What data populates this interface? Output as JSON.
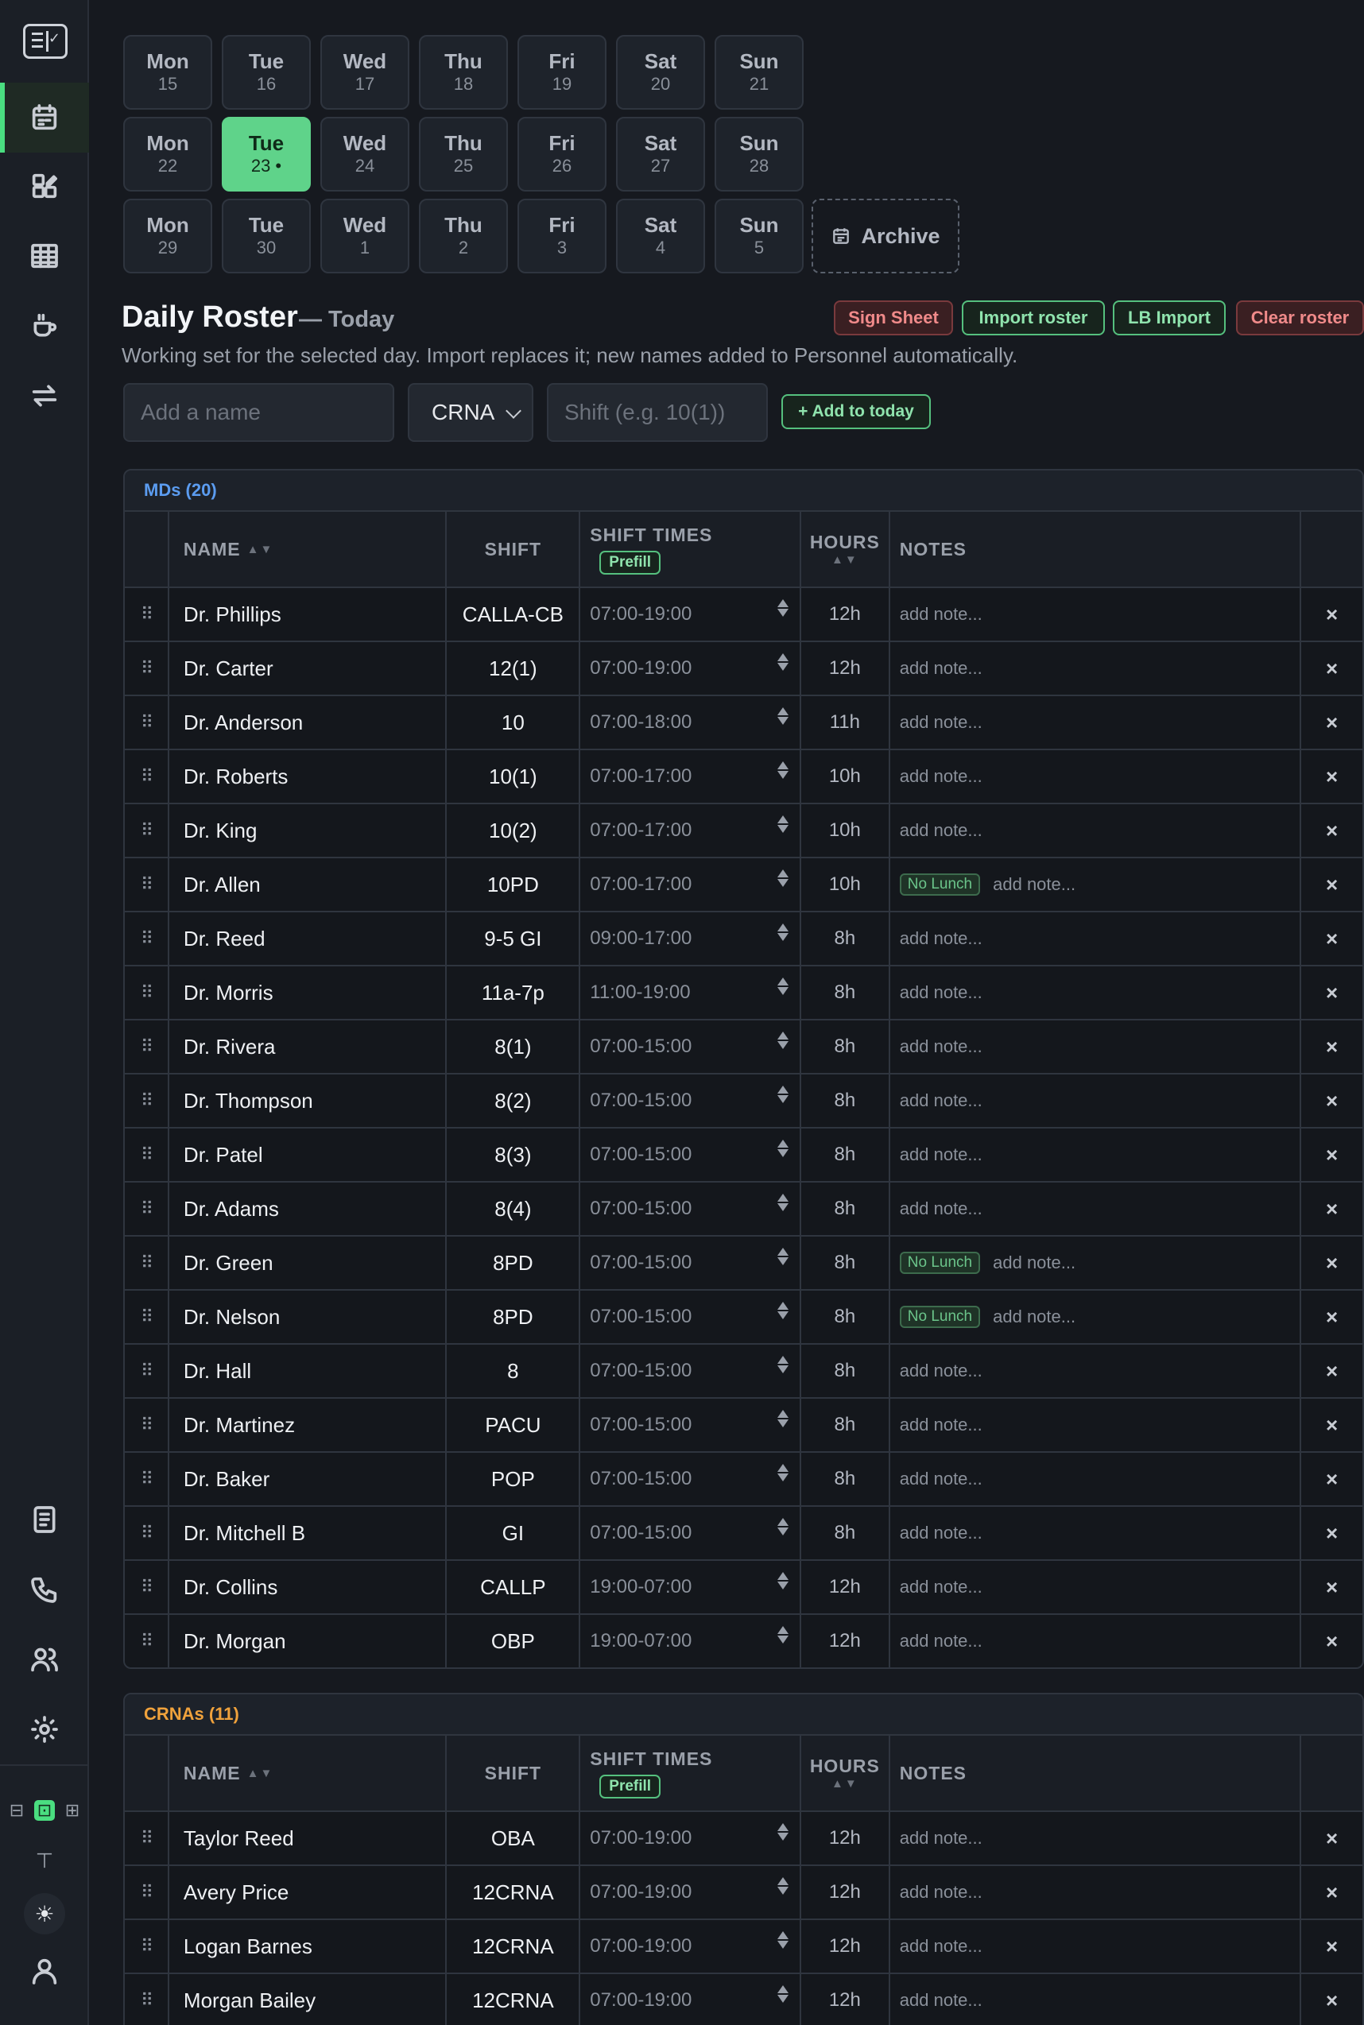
{
  "sidebar": {
    "items": [
      {
        "name": "calendar-icon",
        "active": true
      },
      {
        "name": "apps-edit-icon",
        "active": false
      },
      {
        "name": "table-icon",
        "active": false
      },
      {
        "name": "coffee-cup-icon",
        "active": false
      },
      {
        "name": "swap-arrows-icon",
        "active": false
      }
    ],
    "bottom_items": [
      {
        "name": "document-icon"
      },
      {
        "name": "phone-icon"
      },
      {
        "name": "users-icon"
      },
      {
        "name": "settings-icon"
      }
    ],
    "layout_toggle": [
      "⊟",
      "⊡",
      "⊞"
    ],
    "text_size_glyph": "⊤",
    "theme_glyph": "☀"
  },
  "calendar": {
    "weeks": [
      [
        {
          "day": "Mon",
          "date": "15"
        },
        {
          "day": "Tue",
          "date": "16"
        },
        {
          "day": "Wed",
          "date": "17"
        },
        {
          "day": "Thu",
          "date": "18"
        },
        {
          "day": "Fri",
          "date": "19"
        },
        {
          "day": "Sat",
          "date": "20"
        },
        {
          "day": "Sun",
          "date": "21"
        }
      ],
      [
        {
          "day": "Mon",
          "date": "22"
        },
        {
          "day": "Tue",
          "date": "23 •",
          "selected": true
        },
        {
          "day": "Wed",
          "date": "24"
        },
        {
          "day": "Thu",
          "date": "25"
        },
        {
          "day": "Fri",
          "date": "26"
        },
        {
          "day": "Sat",
          "date": "27"
        },
        {
          "day": "Sun",
          "date": "28"
        }
      ],
      [
        {
          "day": "Mon",
          "date": "29"
        },
        {
          "day": "Tue",
          "date": "30"
        },
        {
          "day": "Wed",
          "date": "1"
        },
        {
          "day": "Thu",
          "date": "2"
        },
        {
          "day": "Fri",
          "date": "3"
        },
        {
          "day": "Sat",
          "date": "4"
        },
        {
          "day": "Sun",
          "date": "5"
        }
      ]
    ],
    "archive_label": "Archive"
  },
  "header": {
    "title": "Daily Roster",
    "title_suffix": "— Today",
    "subtitle": "Working set for the selected day. Import replaces it; new names added to Personnel automatically.",
    "buttons": {
      "sign_sheet": "Sign Sheet",
      "import_roster": "Import roster",
      "lb_import": "LB Import",
      "clear_roster": "Clear roster"
    }
  },
  "add_form": {
    "name_placeholder": "Add a name",
    "role_value": "CRNA",
    "shift_placeholder": "Shift (e.g. 10(1))",
    "add_label": "+ Add to today"
  },
  "columns": {
    "name": "NAME",
    "name_sort": "▲▼",
    "shift": "SHIFT",
    "shift_times": "SHIFT TIMES",
    "prefill": "Prefill",
    "hours": "HOURS",
    "hours_sort": "▲▼",
    "notes": "NOTES"
  },
  "colors": {
    "md_accent": "#5b9cf0",
    "crna_accent": "#f0a23c",
    "selected_day": "#5fd38a"
  },
  "note_placeholder": "add note...",
  "remove_glyph": "×",
  "grip_glyph": "⠿",
  "no_lunch_label": "No Lunch",
  "mds": {
    "heading": "MDs (20)",
    "rows": [
      {
        "name": "Dr. Phillips",
        "shift": "CALLA-CB",
        "times": "07:00-19:00",
        "hours": "12h"
      },
      {
        "name": "Dr. Carter",
        "shift": "12(1)",
        "times": "07:00-19:00",
        "hours": "12h"
      },
      {
        "name": "Dr. Anderson",
        "shift": "10",
        "times": "07:00-18:00",
        "hours": "11h"
      },
      {
        "name": "Dr. Roberts",
        "shift": "10(1)",
        "times": "07:00-17:00",
        "hours": "10h"
      },
      {
        "name": "Dr. King",
        "shift": "10(2)",
        "times": "07:00-17:00",
        "hours": "10h"
      },
      {
        "name": "Dr. Allen",
        "shift": "10PD",
        "times": "07:00-17:00",
        "hours": "10h",
        "no_lunch": true
      },
      {
        "name": "Dr. Reed",
        "shift": "9-5 GI",
        "times": "09:00-17:00",
        "hours": "8h"
      },
      {
        "name": "Dr. Morris",
        "shift": "11a-7p",
        "times": "11:00-19:00",
        "hours": "8h"
      },
      {
        "name": "Dr. Rivera",
        "shift": "8(1)",
        "times": "07:00-15:00",
        "hours": "8h"
      },
      {
        "name": "Dr. Thompson",
        "shift": "8(2)",
        "times": "07:00-15:00",
        "hours": "8h"
      },
      {
        "name": "Dr. Patel",
        "shift": "8(3)",
        "times": "07:00-15:00",
        "hours": "8h"
      },
      {
        "name": "Dr. Adams",
        "shift": "8(4)",
        "times": "07:00-15:00",
        "hours": "8h"
      },
      {
        "name": "Dr. Green",
        "shift": "8PD",
        "times": "07:00-15:00",
        "hours": "8h",
        "no_lunch": true
      },
      {
        "name": "Dr. Nelson",
        "shift": "8PD",
        "times": "07:00-15:00",
        "hours": "8h",
        "no_lunch": true
      },
      {
        "name": "Dr. Hall",
        "shift": "8",
        "times": "07:00-15:00",
        "hours": "8h"
      },
      {
        "name": "Dr. Martinez",
        "shift": "PACU",
        "times": "07:00-15:00",
        "hours": "8h"
      },
      {
        "name": "Dr. Baker",
        "shift": "POP",
        "times": "07:00-15:00",
        "hours": "8h"
      },
      {
        "name": "Dr. Mitchell B",
        "shift": "GI",
        "times": "07:00-15:00",
        "hours": "8h"
      },
      {
        "name": "Dr. Collins",
        "shift": "CALLP",
        "times": "19:00-07:00",
        "hours": "12h"
      },
      {
        "name": "Dr. Morgan",
        "shift": "OBP",
        "times": "19:00-07:00",
        "hours": "12h"
      }
    ]
  },
  "crnas": {
    "heading": "CRNAs (11)",
    "rows": [
      {
        "name": "Taylor Reed",
        "shift": "OBA",
        "times": "07:00-19:00",
        "hours": "12h"
      },
      {
        "name": "Avery Price",
        "shift": "12CRNA",
        "times": "07:00-19:00",
        "hours": "12h"
      },
      {
        "name": "Logan Barnes",
        "shift": "12CRNA",
        "times": "07:00-19:00",
        "hours": "12h"
      },
      {
        "name": "Morgan Bailey",
        "shift": "12CRNA",
        "times": "07:00-19:00",
        "hours": "12h"
      }
    ]
  }
}
